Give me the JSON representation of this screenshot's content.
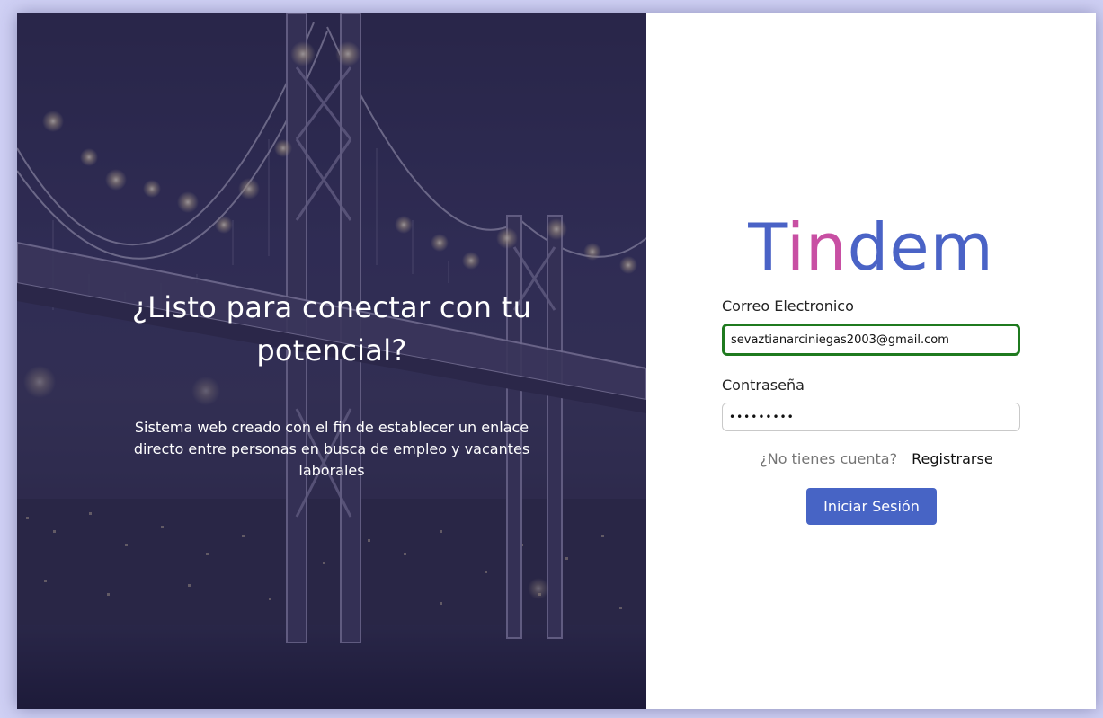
{
  "hero": {
    "title": "¿Listo para conectar con tu potencial?",
    "description": "Sistema web creado con el fin de establecer un enlace directo entre personas en busca de empleo y vacantes laborales"
  },
  "brand": {
    "part1": "T",
    "part2": "in",
    "part3": "dem",
    "colors": {
      "blue": "#4a63c6",
      "pink": "#c84fa3"
    }
  },
  "form": {
    "email_label": "Correo Electronico",
    "email_value": "sevaztianarciniegas2003@gmail.com",
    "password_label": "Contraseña",
    "password_value": "•••••••••",
    "signup_question": "¿No tienes cuenta?",
    "signup_link": "Registrarse",
    "submit_label": "Iniciar Sesión"
  },
  "colors": {
    "accent": "#4764c5",
    "focus_border": "#1f7a1f"
  }
}
